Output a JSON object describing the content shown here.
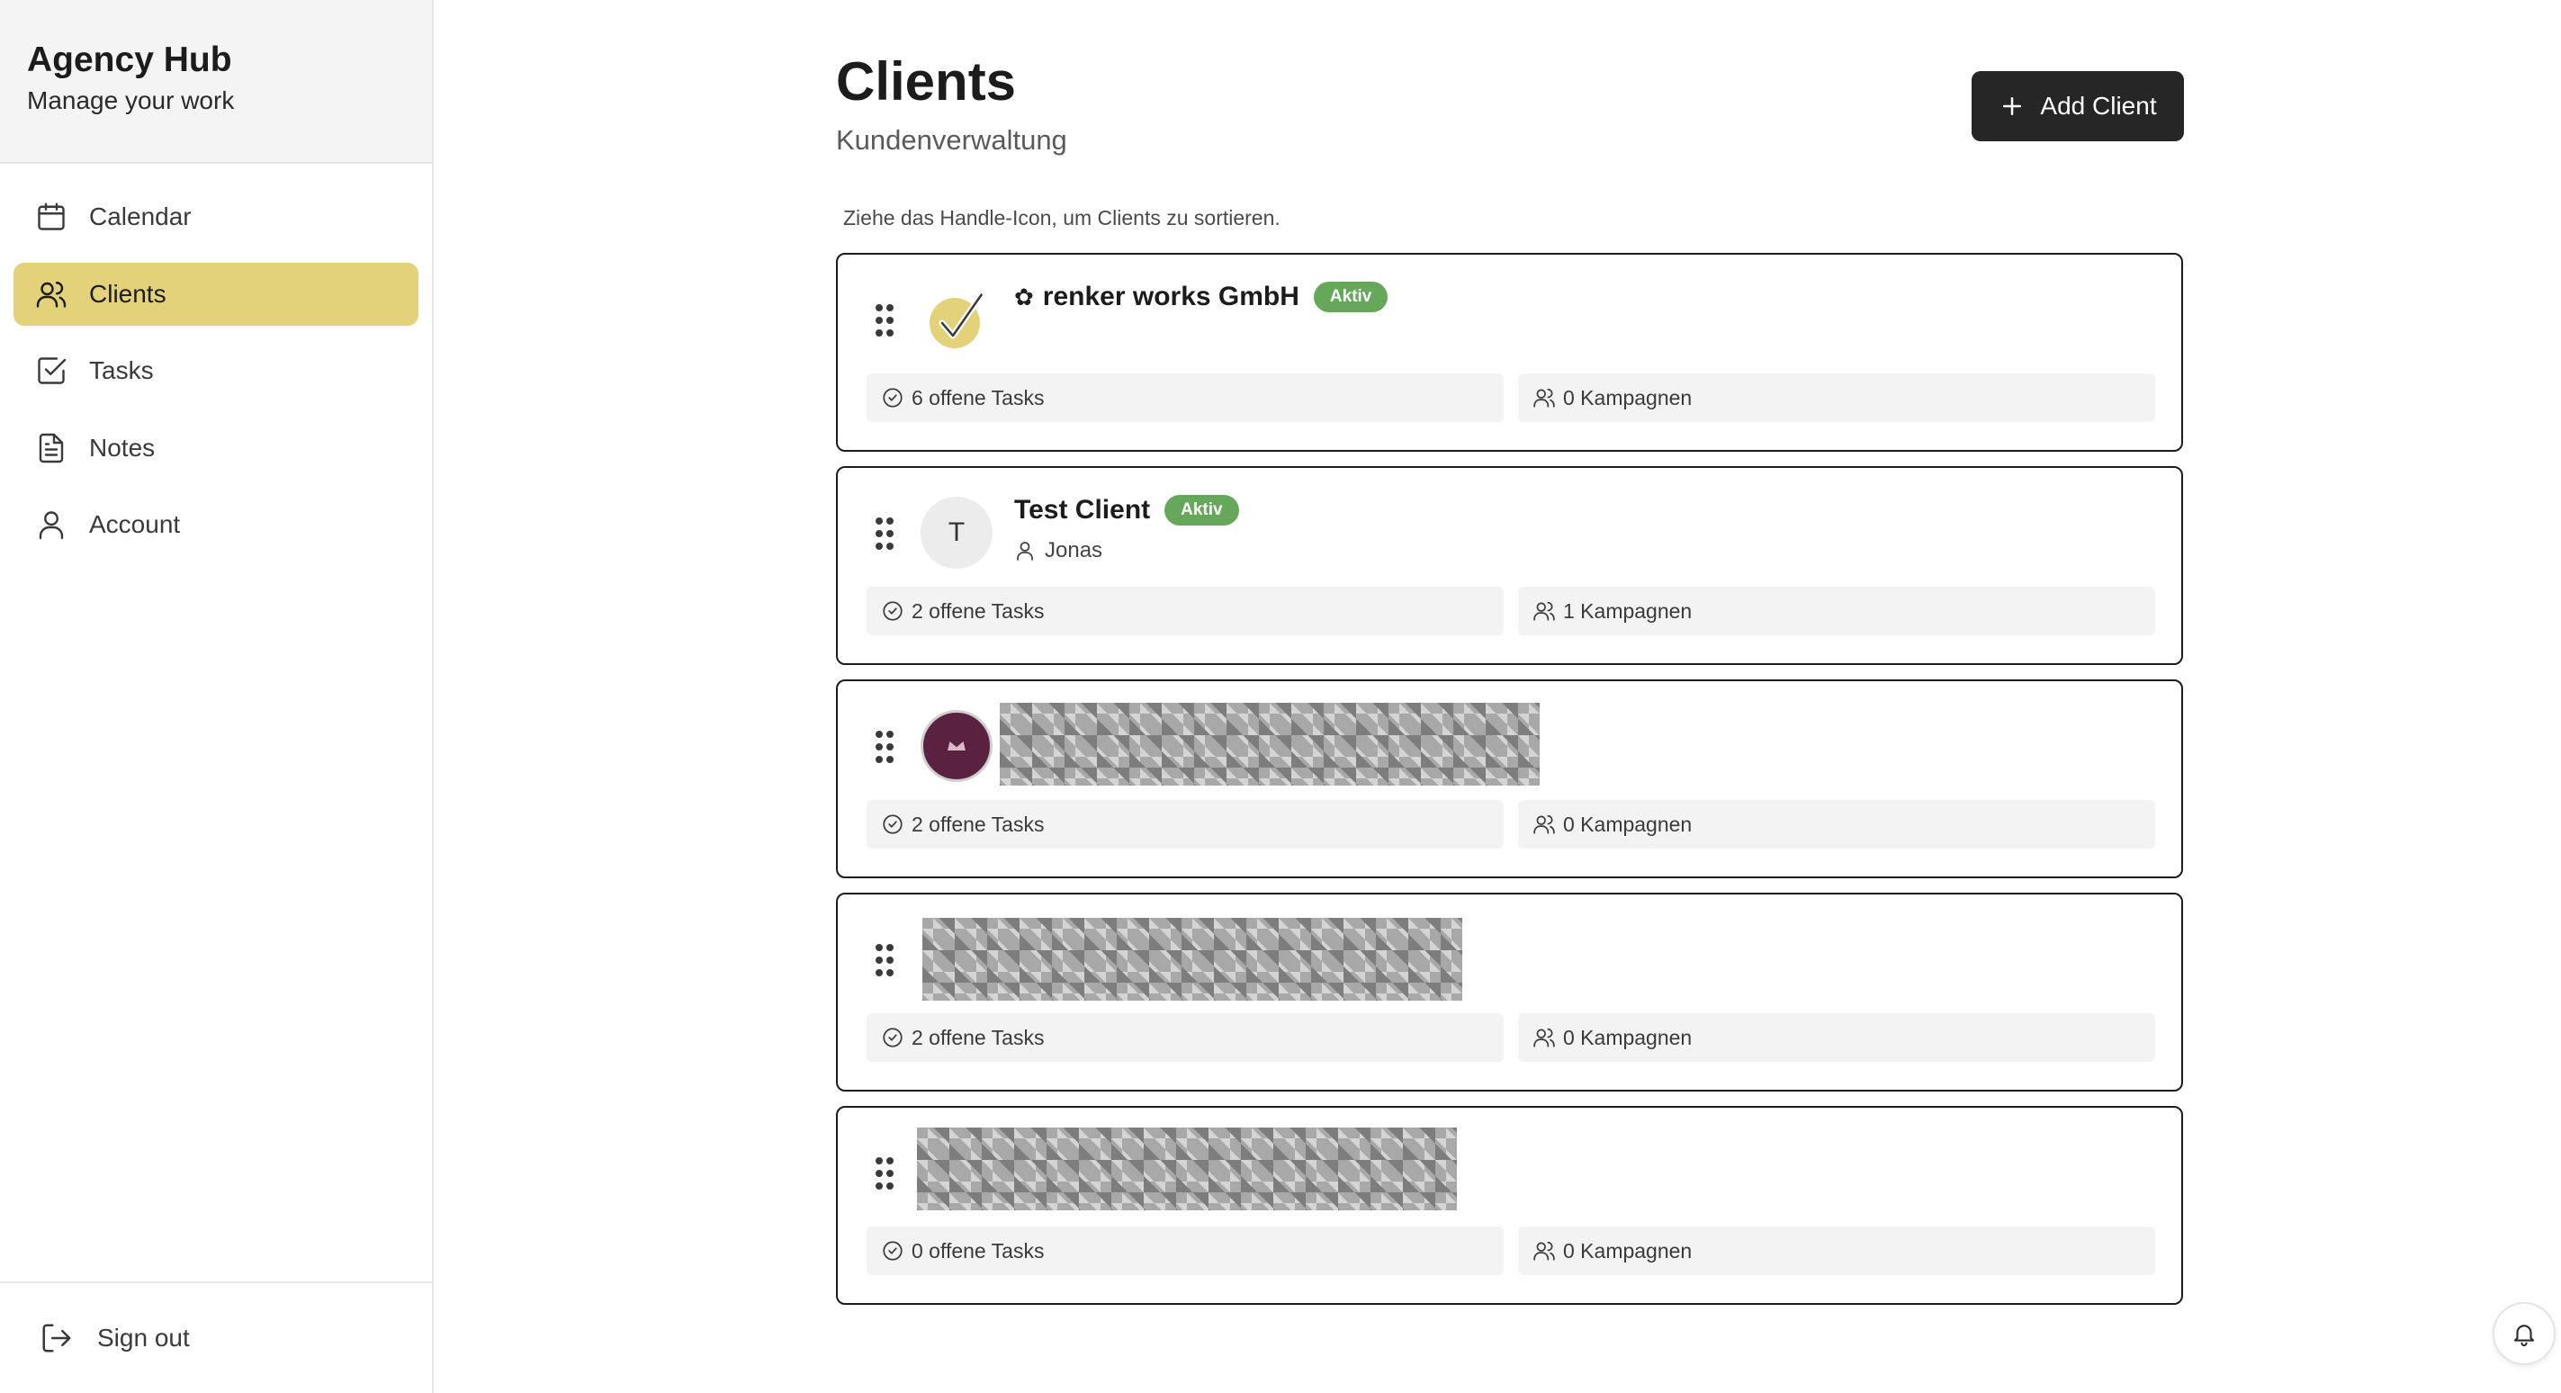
{
  "app": {
    "title": "Agency Hub",
    "subtitle": "Manage your work"
  },
  "sidebar": {
    "items": [
      {
        "label": "Calendar",
        "icon": "calendar-icon",
        "active": false
      },
      {
        "label": "Clients",
        "icon": "users-icon",
        "active": true
      },
      {
        "label": "Tasks",
        "icon": "checkbox-icon",
        "active": false
      },
      {
        "label": "Notes",
        "icon": "document-icon",
        "active": false
      },
      {
        "label": "Account",
        "icon": "user-icon",
        "active": false
      }
    ],
    "sign_out_label": "Sign out"
  },
  "page": {
    "title": "Clients",
    "subtitle": "Kundenverwaltung",
    "add_button_label": "Add Client",
    "hint": "Ziehe das Handle-Icon, um Clients zu sortieren."
  },
  "clients": [
    {
      "name": "renker works GmbH",
      "status": "Aktiv",
      "contact": "",
      "tasks": "6 offene Tasks",
      "campaigns": "0 Kampagnen"
    },
    {
      "name": "Test Client",
      "avatar_letter": "T",
      "status": "Aktiv",
      "contact": "Jonas",
      "tasks": "2 offene Tasks",
      "campaigns": "1 Kampagnen"
    },
    {
      "name": "",
      "status": "",
      "contact": "",
      "tasks": "2 offene Tasks",
      "campaigns": "0 Kampagnen"
    },
    {
      "name": "",
      "status": "",
      "contact": "",
      "tasks": "2 offene Tasks",
      "campaigns": "0 Kampagnen"
    },
    {
      "name": "",
      "status": "",
      "contact": "",
      "tasks": "0 offene Tasks",
      "campaigns": "0 Kampagnen"
    }
  ],
  "colors": {
    "accent": "#e4d27a",
    "status_active": "#65a85a",
    "primary_button": "#262626"
  }
}
